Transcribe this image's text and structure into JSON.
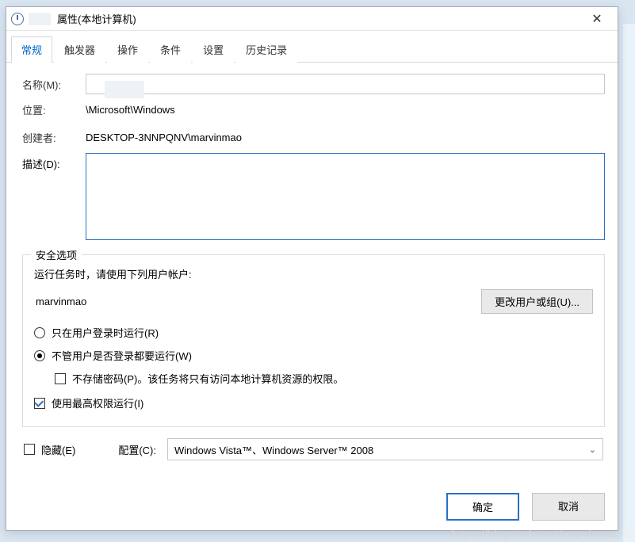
{
  "window": {
    "title": "属性(本地计算机)"
  },
  "tabs": [
    "常规",
    "触发器",
    "操作",
    "条件",
    "设置",
    "历史记录"
  ],
  "general": {
    "name_label": "名称(M):",
    "name_value": "",
    "location_label": "位置:",
    "location_value": "\\Microsoft\\Windows",
    "creator_label": "创建者:",
    "creator_value": "DESKTOP-3NNPQNV\\marvinmao",
    "description_label": "描述(D):",
    "description_value": ""
  },
  "security": {
    "group_title": "安全选项",
    "prompt": "运行任务时，请使用下列用户帐户:",
    "user": "marvinmao",
    "change_user_btn": "更改用户或组(U)...",
    "radio_logged_on": "只在用户登录时运行(R)",
    "radio_any": "不管用户是否登录都要运行(W)",
    "no_store_pwd": "不存储密码(P)。该任务将只有访问本地计算机资源的权限。",
    "highest_priv": "使用最高权限运行(I)"
  },
  "bottom": {
    "hidden_label": "隐藏(E)",
    "config_label": "配置(C):",
    "config_value": "Windows Vista™、Windows Server™ 2008"
  },
  "footer": {
    "ok": "确定",
    "cancel": "取消"
  },
  "watermark": "https://blog.csdn.net/marvinmao"
}
